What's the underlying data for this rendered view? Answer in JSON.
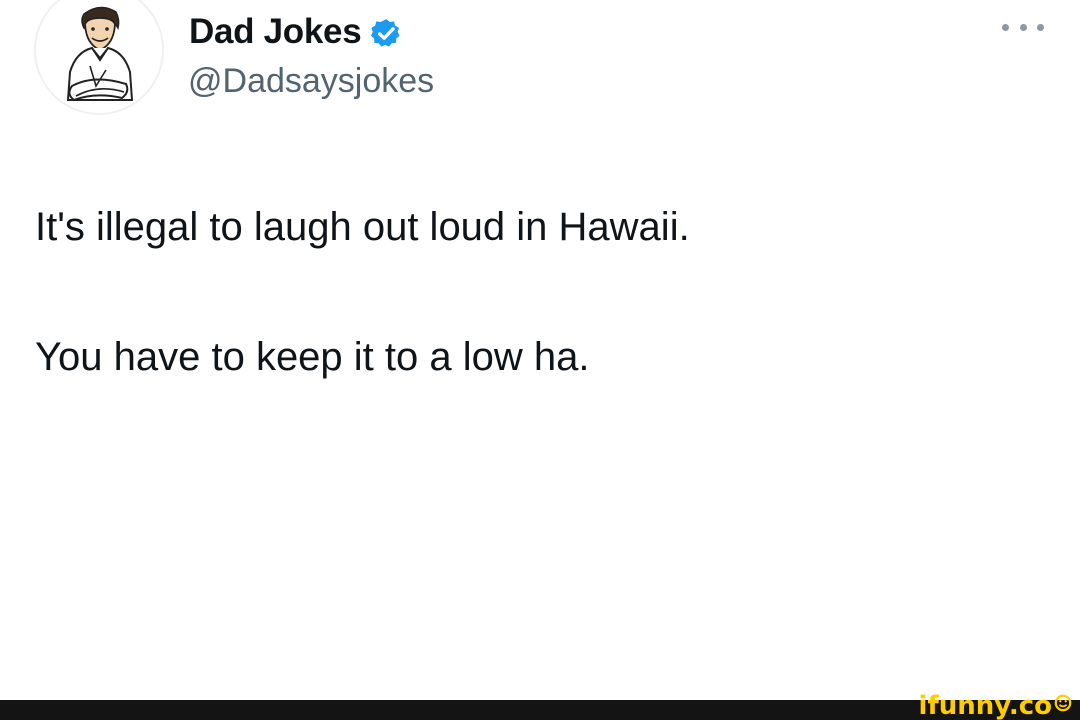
{
  "tweet": {
    "author": {
      "display_name": "Dad Jokes",
      "handle": "@Dadsaysjokes",
      "verified": true,
      "avatar_icon": "cartoon-man-avatar",
      "verified_icon": "verified-badge-icon",
      "verified_color": "#1d9bf0"
    },
    "more_icon": "more-options-icon",
    "text_lines": [
      "It's illegal to laugh out loud in Hawaii.",
      "You have to keep it to a low ha."
    ]
  },
  "watermark": {
    "text": "ifunny.co",
    "logo_icon": "smiley-icon",
    "color": "#ffcc00",
    "bar_color": "#141414"
  },
  "colors": {
    "text_primary": "#0f1419",
    "text_secondary": "#536471",
    "background": "#ffffff"
  }
}
